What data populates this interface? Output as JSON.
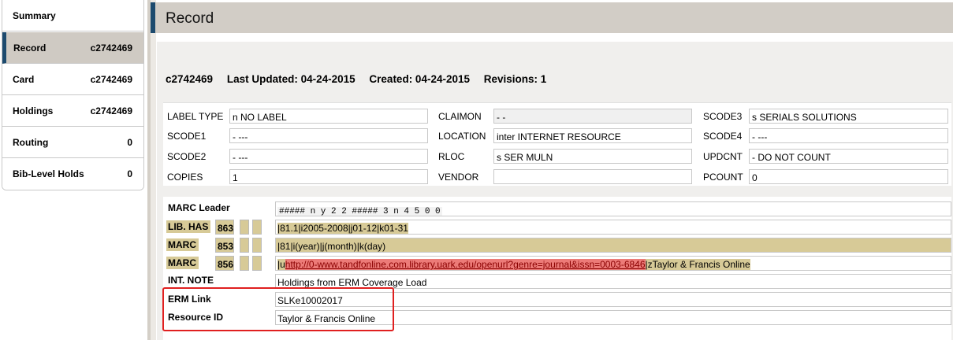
{
  "sidebar": {
    "items": [
      {
        "label": "Summary",
        "value": ""
      },
      {
        "label": "Record",
        "value": "c2742469"
      },
      {
        "label": "Card",
        "value": "c2742469"
      },
      {
        "label": "Holdings",
        "value": "c2742469"
      },
      {
        "label": "Routing",
        "value": "0"
      },
      {
        "label": "Bib-Level Holds",
        "value": "0"
      }
    ],
    "active_index": 1
  },
  "header": {
    "title": "Record"
  },
  "meta": {
    "record_id": "c2742469",
    "last_updated": "Last Updated: 04-24-2015",
    "created": "Created: 04-24-2015",
    "revisions": "Revisions: 1"
  },
  "fixed_fields": {
    "label_type": {
      "label": "LABEL TYPE",
      "value": "n  NO LABEL"
    },
    "claimon": {
      "label": "CLAIMON",
      "value": "-  -"
    },
    "scode3": {
      "label": "SCODE3",
      "value": "s  SERIALS SOLUTIONS"
    },
    "scode1": {
      "label": "SCODE1",
      "value": "-  ---"
    },
    "location": {
      "label": "LOCATION",
      "value": "inter  INTERNET RESOURCE"
    },
    "scode4": {
      "label": "SCODE4",
      "value": "-  ---"
    },
    "scode2": {
      "label": "SCODE2",
      "value": "-  ---"
    },
    "rloc": {
      "label": "RLOC",
      "value": "s   SER MULN"
    },
    "updcnt": {
      "label": "UPDCNT",
      "value": "-  DO NOT COUNT"
    },
    "copies": {
      "label": "COPIES",
      "value": "1"
    },
    "vendor": {
      "label": "VENDOR",
      "value": ""
    },
    "pcount": {
      "label": "PCOUNT",
      "value": "0"
    }
  },
  "variable_fields": {
    "leader": {
      "label": "MARC Leader",
      "value": "#####  n  y       2  2  #####  3  n     4  5  0  0"
    },
    "lib_has": {
      "label": "LIB. HAS",
      "tag": "863",
      "value": "|81.1|i2005-2008|j01-12|k01-31"
    },
    "marc853": {
      "label": "MARC",
      "tag": "853",
      "value": "|81|i(year)|j(month)|k(day)"
    },
    "marc856": {
      "label": "MARC",
      "tag": "856",
      "prefix": "|u",
      "url": "http://0-www.tandfonline.com.library.uark.edu/openurl?genre=journal&issn=0003-6846",
      "suffix": "|zTaylor & Francis Online"
    },
    "int_note": {
      "label": "INT. NOTE",
      "value": "Holdings from ERM Coverage Load"
    },
    "erm_link": {
      "label": "ERM Link",
      "value": "SLKe10002017"
    },
    "resource_id": {
      "label": "Resource ID",
      "value": "Taylor & Francis Online"
    }
  },
  "colors": {
    "accent": "#1c4a6e",
    "marc_highlight": "#d7ca97",
    "url_highlight": "#ec7b78",
    "annotation_box": "#e02020"
  }
}
